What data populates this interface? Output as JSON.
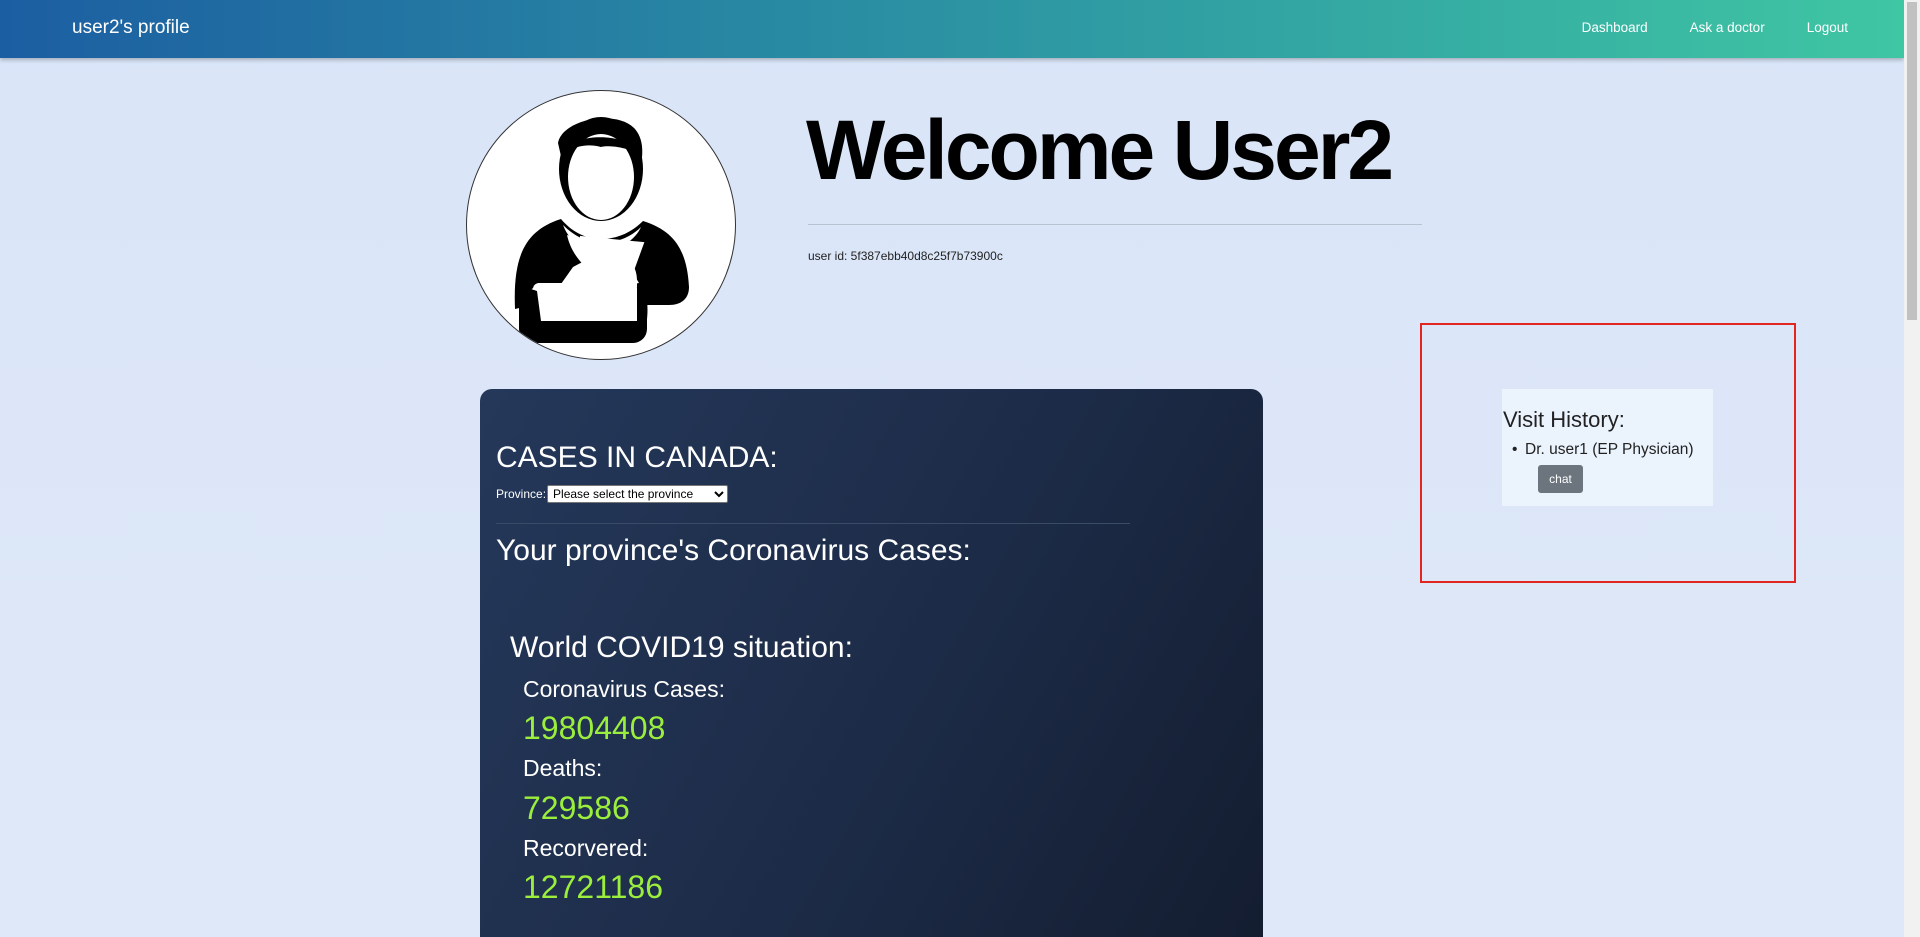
{
  "navbar": {
    "brand": "user2's profile",
    "links": {
      "dashboard": "Dashboard",
      "ask_doctor": "Ask a doctor",
      "logout": "Logout"
    },
    "gradient": [
      "#1c5ea2",
      "#3fc6a3"
    ]
  },
  "profile": {
    "avatar_icon": "injured-person-arm-sling-icon",
    "welcome": "Welcome User2",
    "user_id": "user id: 5f387ebb40d8c25f7b73900c"
  },
  "cases": {
    "title": "CASES IN CANADA:",
    "province_label": "Province:",
    "province_selected": "Please select the province",
    "province_heading": "Your province's Coronavirus Cases:",
    "world_title": "World COVID19 situation:",
    "stats": {
      "cases_label": "Coronavirus Cases:",
      "cases_value": "19804408",
      "deaths_label": "Deaths:",
      "deaths_value": "729586",
      "recovered_label": "Recorvered:",
      "recovered_value": "12721186"
    },
    "value_color": "#9bef3c"
  },
  "visit_history": {
    "title": "Visit History:",
    "items": [
      {
        "doctor": "Dr. user1 (EP Physician)",
        "chat_label": "chat"
      }
    ],
    "highlight_color": "#e0261e"
  }
}
